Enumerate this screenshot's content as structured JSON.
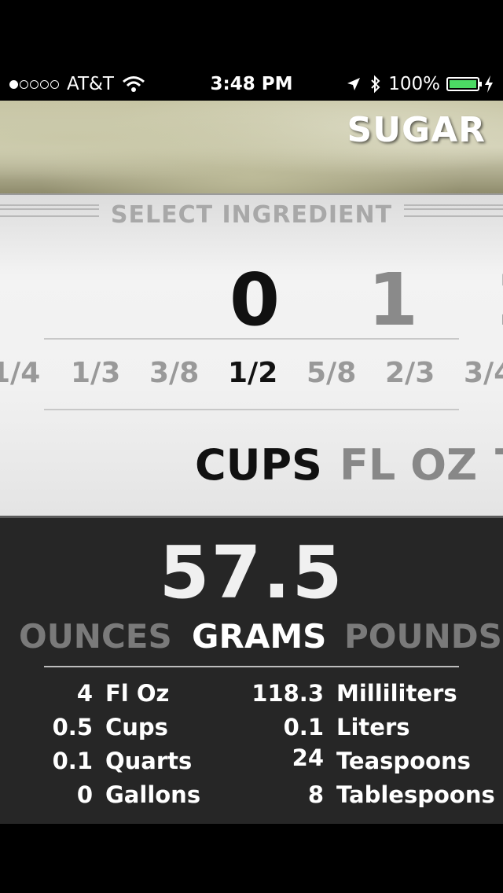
{
  "status_bar": {
    "carrier": "AT&T",
    "time": "3:48 PM",
    "battery": "100%"
  },
  "header": {
    "title": "SUGAR"
  },
  "selector": {
    "label": "SELECT INGREDIENT",
    "wholes": [
      "0",
      "1"
    ],
    "fractions": [
      "1/4",
      "1/3",
      "3/8",
      "1/2",
      "5/8",
      "2/3",
      "3/4"
    ],
    "selected_fraction": "1/2",
    "units": [
      "CUPS",
      "FL OZ"
    ],
    "selected_unit": "CUPS"
  },
  "result": {
    "value": "57.5",
    "weight_units": [
      "OUNCES",
      "GRAMS",
      "POUNDS"
    ],
    "selected_weight_unit": "GRAMS"
  },
  "conversions": {
    "left": [
      {
        "value": "4",
        "unit": "Fl Oz"
      },
      {
        "value": "0.5",
        "unit": "Cups"
      },
      {
        "value": "0.1",
        "unit": "Quarts"
      },
      {
        "value": "0",
        "unit": "Gallons"
      }
    ],
    "right": [
      {
        "value": "118.3",
        "unit": "Milliliters"
      },
      {
        "value": "0.1",
        "unit": "Liters"
      },
      {
        "value": "24",
        "unit": "Teaspoons"
      },
      {
        "value": "8",
        "unit": "Tablespoons"
      }
    ]
  },
  "colors": {
    "battery": "#4cd964",
    "results_bg": "#262626"
  }
}
